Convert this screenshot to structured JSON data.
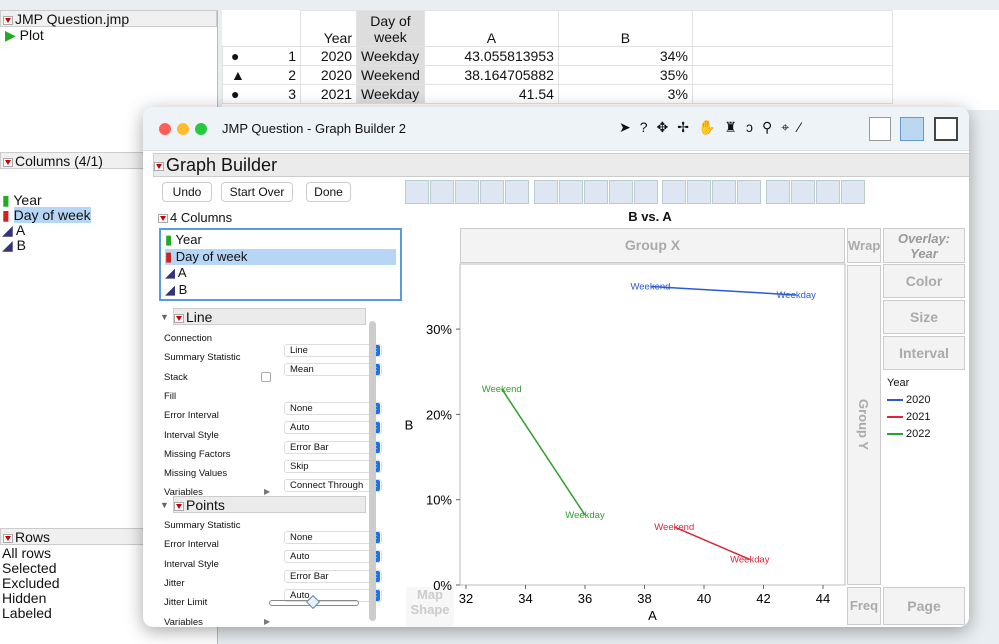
{
  "left": {
    "file": "JMP Question.jmp",
    "script": "Plot",
    "columns_header": "Columns (4/1)",
    "columns": [
      "Year",
      "Day of week",
      "A",
      "B"
    ],
    "rows_header": "Rows",
    "rows": [
      [
        "All rows"
      ],
      [
        "Selected"
      ],
      [
        "Excluded"
      ],
      [
        "Hidden"
      ],
      [
        "Labeled"
      ]
    ]
  },
  "table": {
    "headers": [
      "Year",
      "Day of week",
      "A",
      "B"
    ],
    "rows": [
      [
        "1",
        "2020",
        "Weekday",
        "43.055813953",
        "34%"
      ],
      [
        "2",
        "2020",
        "Weekend",
        "38.164705882",
        "35%"
      ],
      [
        "3",
        "2021",
        "Weekday",
        "41.54",
        "3%"
      ]
    ]
  },
  "window": {
    "title": "JMP Question - Graph Builder 2",
    "section": "Graph Builder",
    "buttons": [
      "Undo",
      "Start Over",
      "Done"
    ],
    "columns_label": "4 Columns",
    "columns": [
      "Year",
      "Day of week",
      "A",
      "B"
    ],
    "line_section": "Line",
    "line_props": [
      [
        "Connection",
        "Line"
      ],
      [
        "Summary Statistic",
        "Mean"
      ],
      [
        "Stack",
        ""
      ],
      [
        "Fill",
        "None"
      ],
      [
        "Error Interval",
        "Auto"
      ],
      [
        "Interval Style",
        "Error Bar"
      ],
      [
        "Missing Factors",
        "Skip"
      ],
      [
        "Missing Values",
        "Connect Through"
      ],
      [
        "Variables",
        ""
      ]
    ],
    "points_section": "Points",
    "points_props": [
      [
        "Summary Statistic",
        "None"
      ],
      [
        "Error Interval",
        "Auto"
      ],
      [
        "Interval Style",
        "Error Bar"
      ],
      [
        "Jitter",
        "Auto"
      ],
      [
        "Jitter Limit",
        ""
      ],
      [
        "Variables",
        ""
      ]
    ],
    "zones": {
      "group_x": "Group X",
      "group_y": "Group Y",
      "wrap": "Wrap",
      "overlay": "Overlay: Year",
      "color": "Color",
      "size": "Size",
      "interval": "Interval",
      "freq": "Freq",
      "page": "Page",
      "map": "Map Shape"
    }
  },
  "chart_data": {
    "type": "line",
    "title": "B vs. A",
    "xlabel": "A",
    "ylabel": "B",
    "xlim": [
      32,
      44.5
    ],
    "ylim": [
      0,
      40
    ],
    "xticks": [
      "32",
      "34",
      "36",
      "38",
      "40",
      "42",
      "44"
    ],
    "yticks": [
      "0%",
      "10%",
      "20%",
      "30%"
    ],
    "legend_title": "Year",
    "legend": "right",
    "series": [
      {
        "name": "2020",
        "color": "#2a5bd7",
        "points": [
          {
            "label": "Weekend",
            "x": 38.2,
            "y": 35
          },
          {
            "label": "Weekday",
            "x": 43.1,
            "y": 34
          }
        ]
      },
      {
        "name": "2021",
        "color": "#d6283a",
        "points": [
          {
            "label": "Weekend",
            "x": 39.0,
            "y": 6.8
          },
          {
            "label": "Weekday",
            "x": 41.54,
            "y": 3
          }
        ]
      },
      {
        "name": "2022",
        "color": "#2ea02e",
        "points": [
          {
            "label": "Weekend",
            "x": 33.2,
            "y": 23
          },
          {
            "label": "Weekday",
            "x": 36.0,
            "y": 8.2
          }
        ]
      }
    ]
  }
}
